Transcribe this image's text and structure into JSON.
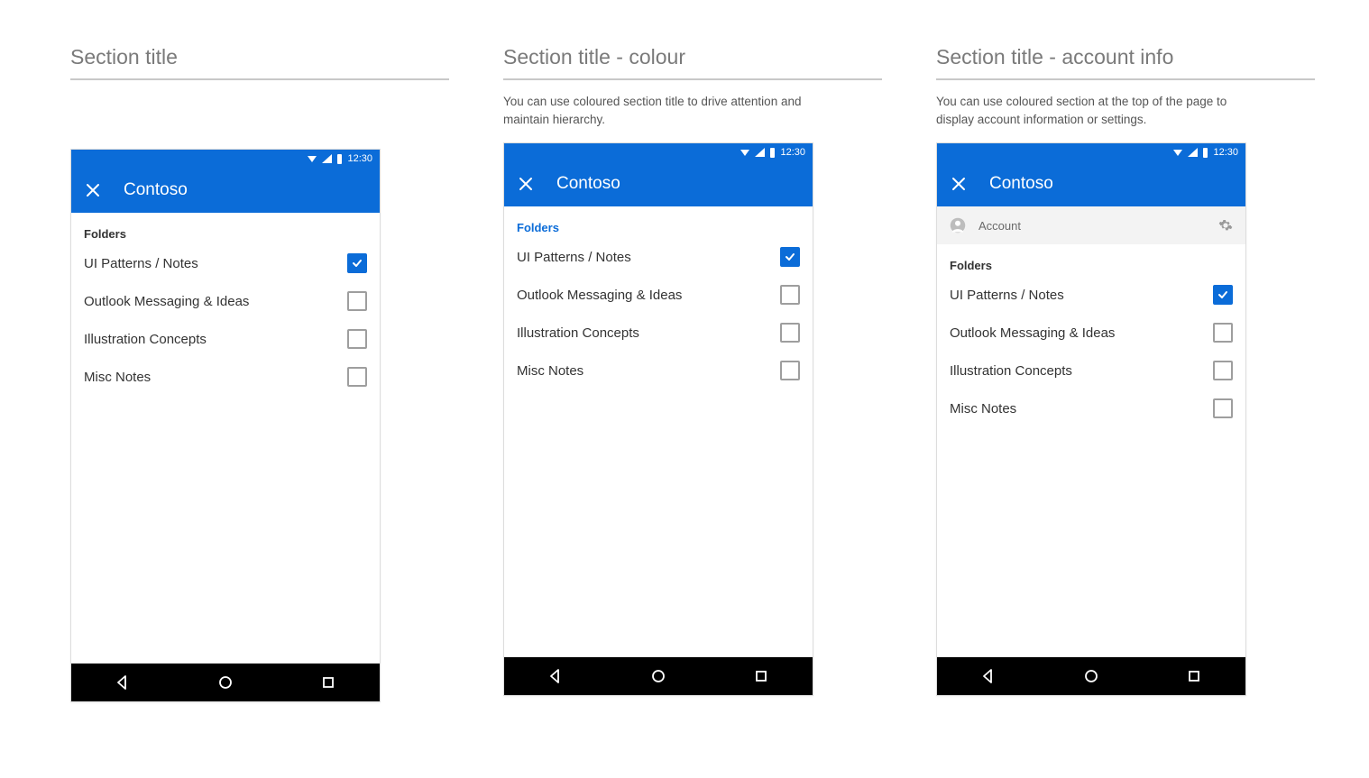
{
  "columns": [
    {
      "title": "Section title",
      "desc": null,
      "variant": "plain"
    },
    {
      "title": "Section title - colour",
      "desc": "You can use coloured section title to drive attention and maintain hierarchy.",
      "variant": "colour"
    },
    {
      "title": "Section title - account info",
      "desc": "You can use coloured section at the top of the page to display account information or settings.",
      "variant": "account"
    }
  ],
  "status": {
    "time": "12:30"
  },
  "app": {
    "title": "Contoso"
  },
  "account": {
    "label": "Account"
  },
  "section": {
    "label": "Folders"
  },
  "rows": [
    {
      "label": "UI Patterns / Notes",
      "checked": true
    },
    {
      "label": "Outlook Messaging & Ideas",
      "checked": false
    },
    {
      "label": "Illustration Concepts",
      "checked": false
    },
    {
      "label": "Misc Notes",
      "checked": false
    }
  ]
}
